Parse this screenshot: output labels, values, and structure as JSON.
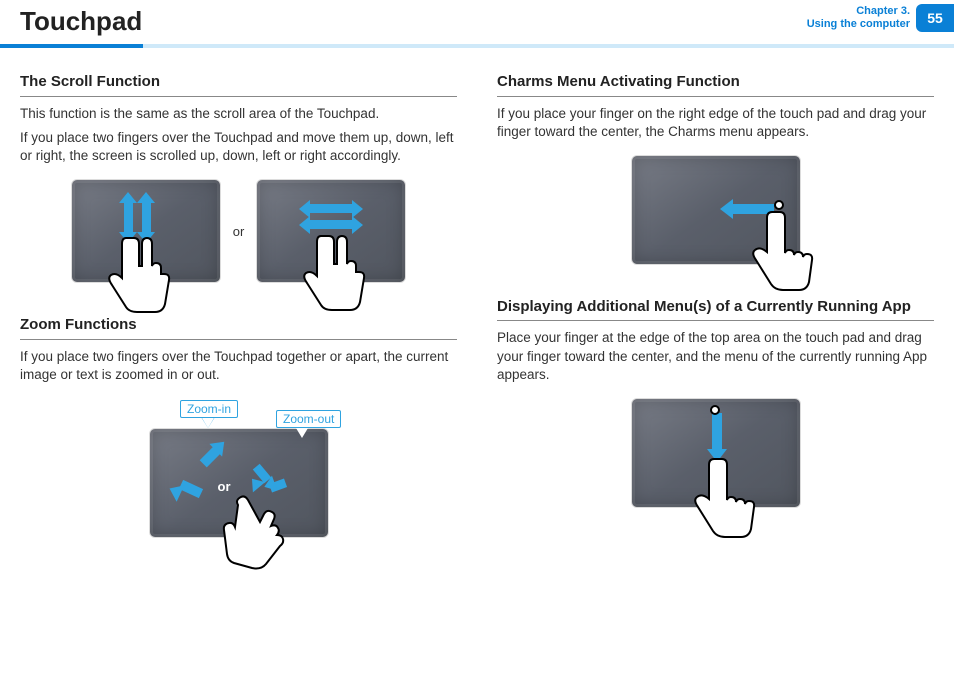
{
  "header": {
    "title": "Touchpad",
    "chapter_line1": "Chapter 3.",
    "chapter_line2": "Using the computer",
    "page": "55"
  },
  "left": {
    "scroll": {
      "heading": "The Scroll Function",
      "p1": "This function is the same as the scroll area of the Touchpad.",
      "p2": "If you place two fingers over the Touchpad and move them up, down, left or right, the screen is scrolled up, down, left or right accordingly.",
      "or": "or"
    },
    "zoom": {
      "heading": "Zoom Functions",
      "p1": "If you place two fingers over the Touchpad together or apart, the current image or text is zoomed in or out.",
      "zoom_in": "Zoom-in",
      "zoom_out": "Zoom-out",
      "or": "or"
    }
  },
  "right": {
    "charms": {
      "heading": "Charms Menu Activating Function",
      "p1": "If you place your finger on the right edge of the touch pad and drag your finger toward the center, the Charms menu appears."
    },
    "menus": {
      "heading": "Displaying Additional Menu(s) of a Currently Running App",
      "p1": "Place your finger at the edge of the top area on the touch pad and drag your finger toward the center, and the menu of the currently running App appears."
    }
  }
}
